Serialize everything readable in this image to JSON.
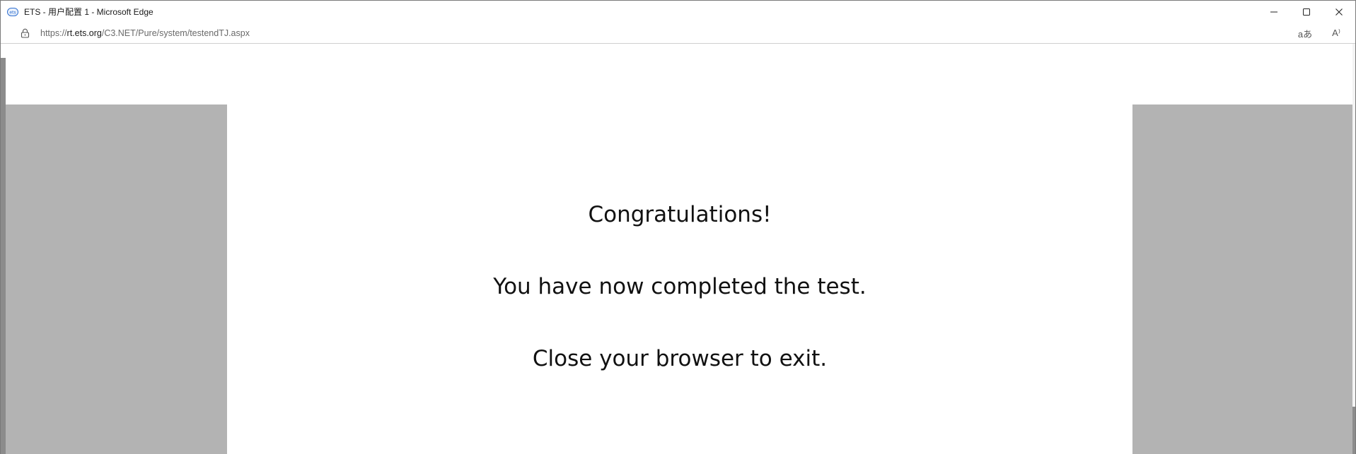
{
  "window": {
    "title": "ETS - 用户配置 1 - Microsoft Edge",
    "app_icon": "edge-profile-icon",
    "controls": [
      "minimize-icon",
      "maximize-icon",
      "close-icon"
    ]
  },
  "address_bar": {
    "url_prefix": "https://",
    "url_host": "rt.ets.org",
    "url_path": "/C3.NET/Pure/system/testendTJ.aspx",
    "lock_icon": "lock-icon",
    "tools": [
      {
        "icon": "translate-icon",
        "label": "aあ"
      },
      {
        "icon": "read-aloud-icon",
        "label": "A⁾"
      }
    ]
  },
  "page": {
    "line1": "Congratulations!",
    "line2": "You have now completed the test.",
    "line3": "Close your browser to exit."
  },
  "colors": {
    "side_panel": "#b3b3b3",
    "content_bg": "#ffffff",
    "text": "#111111"
  }
}
